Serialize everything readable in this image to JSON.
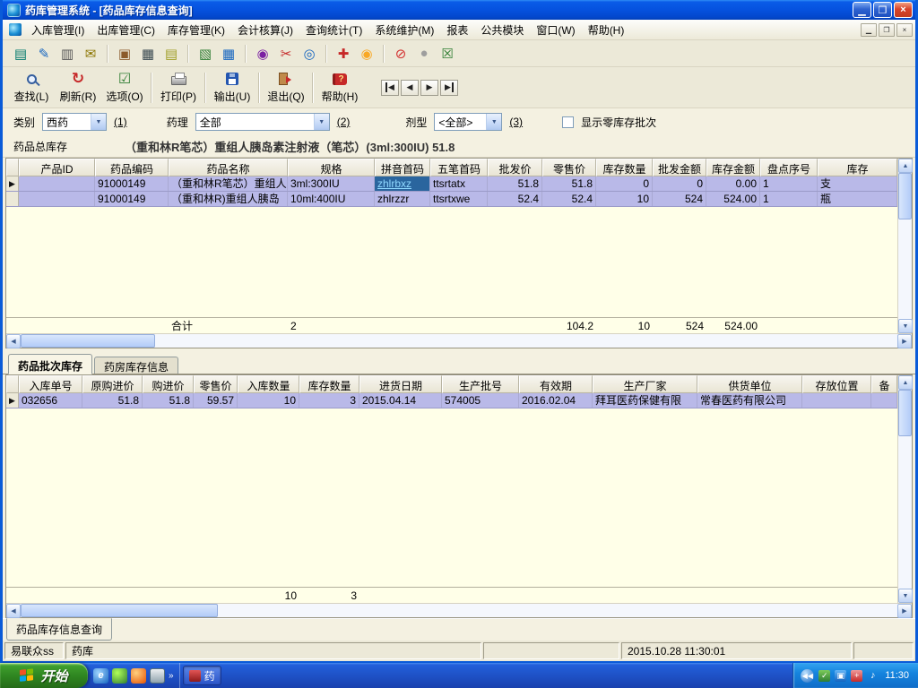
{
  "titlebar": {
    "title": "药库管理系统 - [药品库存信息查询]"
  },
  "menubar": {
    "items": [
      "入库管理(I)",
      "出库管理(C)",
      "库存管理(K)",
      "会计核算(J)",
      "查询统计(T)",
      "系统维护(M)",
      "报表",
      "公共模块",
      "窗口(W)",
      "帮助(H)"
    ]
  },
  "toolbar": {
    "buttons": [
      {
        "label": "查找(L)"
      },
      {
        "label": "刷新(R)"
      },
      {
        "label": "选项(O)"
      },
      {
        "label": "打印(P)"
      },
      {
        "label": "输出(U)"
      },
      {
        "label": "退出(Q)"
      },
      {
        "label": "帮助(H)"
      }
    ]
  },
  "filters": {
    "category": {
      "label": "类别",
      "value": "西药",
      "hotkey": "(1)"
    },
    "pharmacology": {
      "label": "药理",
      "value": "全部",
      "hotkey": "(2)"
    },
    "dosage": {
      "label": "剂型",
      "value": "<全部>",
      "hotkey": "(3)"
    },
    "show_zero_stock": "显示零库存批次"
  },
  "summary": {
    "label": "药品总库存",
    "text": "（重和林R笔芯）重组人胰岛素注射液（笔芯）(3ml:300IU) 51.8"
  },
  "main_table": {
    "columns": [
      "产品ID",
      "药品编码",
      "药品名称",
      "规格",
      "拼音首码",
      "五笔首码",
      "批发价",
      "零售价",
      "库存数量",
      "批发金额",
      "库存金额",
      "盘点序号",
      "库存"
    ],
    "rows": [
      [
        "",
        "91000149",
        "（重和林R笔芯）重组人",
        "3ml:300IU",
        "zhlrbxz",
        "ttsrtatx",
        "51.8",
        "51.8",
        "0",
        "0",
        "0.00",
        "1",
        "支"
      ],
      [
        "",
        "91000149",
        "（重和林R)重组人胰岛",
        "10ml:400IU",
        "zhlrzzr",
        "ttsrtxwe",
        "52.4",
        "52.4",
        "10",
        "524",
        "524.00",
        "1",
        "瓶"
      ]
    ],
    "totals": {
      "label": "合计",
      "spec": "2",
      "retail": "104.2",
      "qty": "10",
      "wholesale_amount": "524",
      "stock_amount": "524.00"
    }
  },
  "tabs": {
    "batch": "药品批次库存",
    "pharmacy": "药房库存信息"
  },
  "detail_table": {
    "columns": [
      "入库单号",
      "原购进价",
      "购进价",
      "零售价",
      "入库数量",
      "库存数量",
      "进货日期",
      "生产批号",
      "有效期",
      "生产厂家",
      "供货单位",
      "存放位置",
      "备"
    ],
    "rows": [
      [
        "032656",
        "51.8",
        "51.8",
        "59.57",
        "10",
        "3",
        "2015.04.14",
        "574005",
        "2016.02.04",
        "拜耳医药保健有限",
        "常春医药有限公司",
        "",
        ""
      ]
    ],
    "totals": {
      "in_qty": "10",
      "stock_qty": "3"
    }
  },
  "bottom_tab": "药品库存信息查询",
  "statusbar": {
    "user": "易联众ss",
    "dept": "药库",
    "datetime": "2015.10.28 11:30:01"
  },
  "taskbar": {
    "start": "开始",
    "app_label": "药",
    "clock": "11:30"
  },
  "colors": {
    "title_bar": "#0653E0",
    "selected_row": "#B9B9E8",
    "focused_cell_bg": "#2A659E",
    "grid_bg": "#FFFFE8",
    "client_bg": "#F4F1E1",
    "taskbar": "#1E50C4",
    "start_button": "#2E8420"
  }
}
